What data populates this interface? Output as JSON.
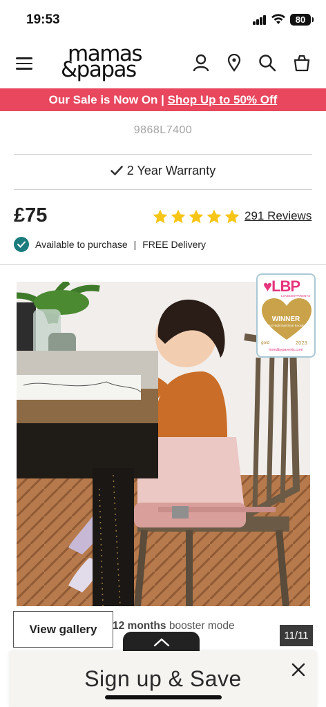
{
  "status_bar": {
    "time": "19:53",
    "battery": "80"
  },
  "header": {
    "logo_line1": "mamas",
    "logo_line2": "&papas"
  },
  "promo": {
    "text": "Our Sale is Now On | ",
    "link": "Shop Up to 50% Off"
  },
  "product": {
    "sku": "9868L7400",
    "warranty": "2 Year Warranty",
    "price": "£75",
    "rating_stars": 5,
    "reviews": "291 Reviews",
    "availability": "Available to purchase",
    "separator": "|",
    "delivery": "FREE Delivery"
  },
  "badge": {
    "brand": "LBP",
    "brand_sub": "LOVEDBYPARENTS",
    "award": "WINNER",
    "award_sub": "Best Highchair/Seat Booster",
    "tier": "gold",
    "year": "2023",
    "url": "lovedbyparents.com"
  },
  "gallery": {
    "button_label": "View gallery",
    "caption_bold": "12 months",
    "caption_rest": " booster mode",
    "counter": "11/11"
  },
  "signup": {
    "title": "Sign up & Save"
  },
  "colors": {
    "promo": "#e8475e",
    "star": "#f7c515",
    "check": "#1b7c7d",
    "badge_pink": "#e6347d",
    "badge_gold": "#c9a24a"
  }
}
